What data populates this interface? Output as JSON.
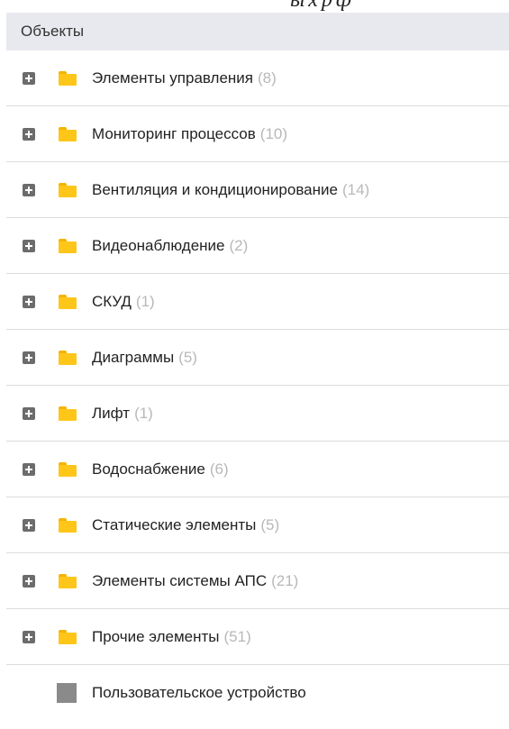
{
  "header": {
    "title": "Объекты"
  },
  "tree": {
    "folders": [
      {
        "label": "Элементы управления",
        "count": "(8)"
      },
      {
        "label": "Мониторинг процессов",
        "count": "(10)"
      },
      {
        "label": "Вентиляция и кондиционирование",
        "count": "(14)"
      },
      {
        "label": "Видеонаблюдение",
        "count": "(2)"
      },
      {
        "label": "СКУД",
        "count": "(1)"
      },
      {
        "label": "Диаграммы",
        "count": "(5)"
      },
      {
        "label": "Лифт",
        "count": "(1)"
      },
      {
        "label": "Водоснабжение",
        "count": "(6)"
      },
      {
        "label": "Статические элементы",
        "count": "(5)"
      },
      {
        "label": "Элементы системы АПС",
        "count": "(21)"
      },
      {
        "label": "Прочие элементы",
        "count": "(51)"
      }
    ],
    "device": {
      "label": "Пользовательское устройство"
    }
  },
  "colors": {
    "header_bg": "#e8e9ee",
    "folder": "#ffc61a",
    "expander": "#6c6c6c",
    "count_text": "#b8b8b8",
    "device_icon": "#8a8a8a"
  },
  "icons": {
    "expander": "plus-square-icon",
    "folder": "folder-icon",
    "device": "gray-square-icon"
  }
}
